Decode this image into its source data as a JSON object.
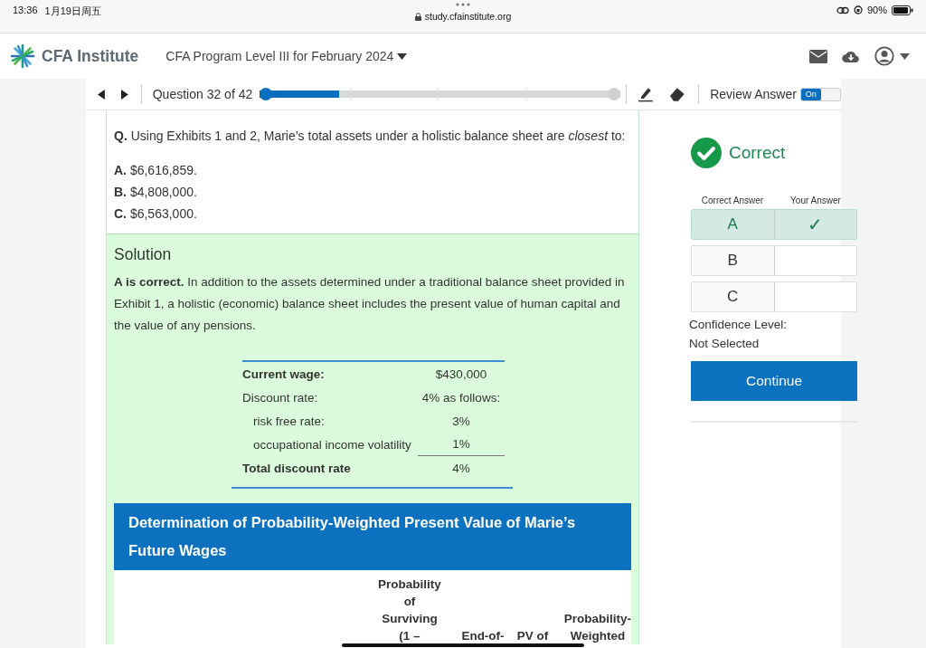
{
  "status_bar": {
    "time": "13:36",
    "date": "1月19日周五",
    "url": "study.cfainstitute.org",
    "battery": "90%"
  },
  "header": {
    "logo_text": "CFA Institute",
    "program_title": "CFA Program Level III for February 2024"
  },
  "toolbar": {
    "question_label": "Question 32 of 42",
    "progress": {
      "level": 0.22
    },
    "review_label": "Review Answer",
    "toggle": {
      "label": "On",
      "on": true
    }
  },
  "question": {
    "prefix": "Q.",
    "text": "Using Exhibits 1 and 2, Marie’s total assets under a holistic balance sheet are *closest* to:",
    "options": [
      {
        "letter": "A.",
        "text": "$6,616,859."
      },
      {
        "letter": "B.",
        "text": "$4,808,000."
      },
      {
        "letter": "C.",
        "text": "$6,563,000."
      }
    ]
  },
  "solution": {
    "title": "Solution",
    "text": "**A is correct.** In addition to the assets determined under a traditional balance sheet provided in Exhibit 1, a holistic (economic) balance sheet includes the present value of human capital and the value of any pensions.",
    "exhibit_rows": [
      {
        "kind": "bold",
        "label": "Current wage:",
        "value": "$430,000"
      },
      {
        "kind": "normal",
        "label": "Discount rate:",
        "value": "4% as follows:"
      },
      {
        "kind": "indented",
        "label": "risk free rate:",
        "value": "3%"
      },
      {
        "kind": "indented",
        "label": "occupational income volatility",
        "value": "1%"
      },
      {
        "kind": "total",
        "label": "Total discount rate",
        "value": "4%"
      }
    ],
    "table_title": "Determination of Probability-Weighted Present Value of Marie’s Future Wages",
    "table_columns": [
      "Probability\nof\nSurviving\n(1 –",
      "End-of-",
      "PV of",
      "Probability-\nWeighted"
    ]
  },
  "result": {
    "status": "Correct",
    "columns": [
      "Correct Answer",
      "Your Answer"
    ],
    "rows": [
      {
        "letter": "A",
        "your_answer": "✓",
        "selected": true
      },
      {
        "letter": "B",
        "selected": false
      },
      {
        "letter": "C",
        "selected": false
      }
    ],
    "confidence_label": "Confidence Level:",
    "confidence_value": "Not Selected",
    "continue_button": "Continue"
  }
}
